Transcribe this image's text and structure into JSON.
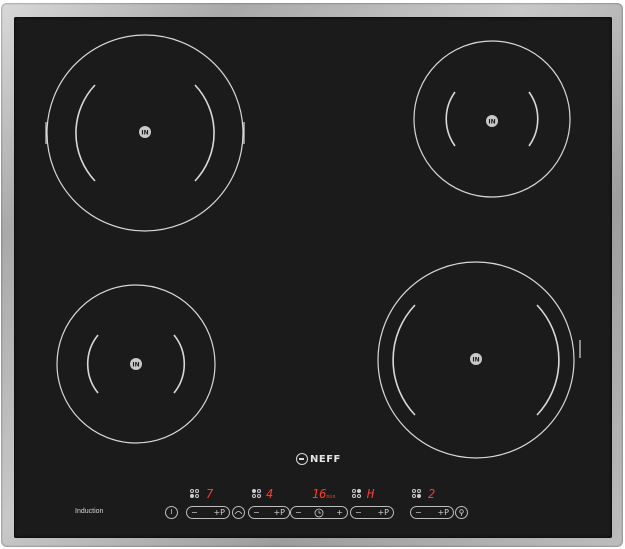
{
  "brand": {
    "name": "NEFF"
  },
  "label": {
    "induction": "Induction"
  },
  "zones": [
    {
      "name": "rear-left-zone",
      "badge": "IN"
    },
    {
      "name": "rear-right-zone",
      "badge": "IN"
    },
    {
      "name": "front-left-zone",
      "badge": "IN"
    },
    {
      "name": "front-right-zone",
      "badge": "IN"
    }
  ],
  "displays": {
    "zone1_level": "7",
    "zone2_level": "4",
    "timer": "16",
    "timer_unit": "min",
    "zone3_level": "H",
    "zone4_level": "2"
  },
  "controls": {
    "power": "I",
    "minus": "−",
    "plus": "+P",
    "plus_plain": "+",
    "wipe": "wipe",
    "lock": "lock"
  },
  "colors": {
    "glass": "#1b1b1b",
    "frame": "#b8b8b8",
    "display_red": "#ff3b2f",
    "printing": "#d9d9d9"
  }
}
